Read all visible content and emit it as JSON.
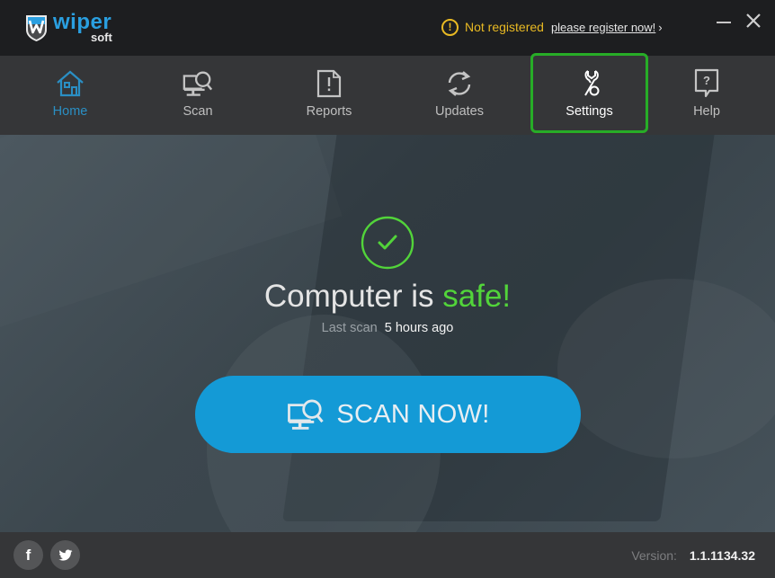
{
  "app": {
    "brand_main": "wiper",
    "brand_sub": "soft"
  },
  "registration": {
    "icon": "warning-circle-icon",
    "status": "Not registered",
    "link": "please register now!",
    "chevron": "›",
    "status_color": "#e8b923"
  },
  "window_controls": {
    "minimize": "minimize-icon",
    "close": "close-icon"
  },
  "nav": {
    "items": [
      {
        "label": "Home",
        "icon": "home-icon",
        "state": "active"
      },
      {
        "label": "Scan",
        "icon": "monitor-search-icon",
        "state": "normal"
      },
      {
        "label": "Reports",
        "icon": "report-document-icon",
        "state": "normal"
      },
      {
        "label": "Updates",
        "icon": "refresh-icon",
        "state": "normal"
      },
      {
        "label": "Settings",
        "icon": "wrench-icon",
        "state": "highlighted"
      },
      {
        "label": "Help",
        "icon": "help-bubble-icon",
        "state": "normal"
      }
    ],
    "active_color": "#2a8fc4",
    "highlight_color": "#27ad27"
  },
  "status": {
    "icon": "check-circle-icon",
    "title_prefix": "Computer is ",
    "title_highlight": "safe!",
    "highlight_color": "#52d43a",
    "last_scan_label": "Last scan",
    "last_scan_value": "5 hours ago"
  },
  "scan_button": {
    "label": "SCAN NOW!",
    "icon": "monitor-search-icon",
    "color": "#149ad6"
  },
  "footer": {
    "social": [
      {
        "name": "facebook",
        "icon": "facebook-icon",
        "glyph": "f"
      },
      {
        "name": "twitter",
        "icon": "twitter-icon"
      }
    ],
    "version_label": "Version:",
    "version_value": "1.1.1134.32"
  }
}
